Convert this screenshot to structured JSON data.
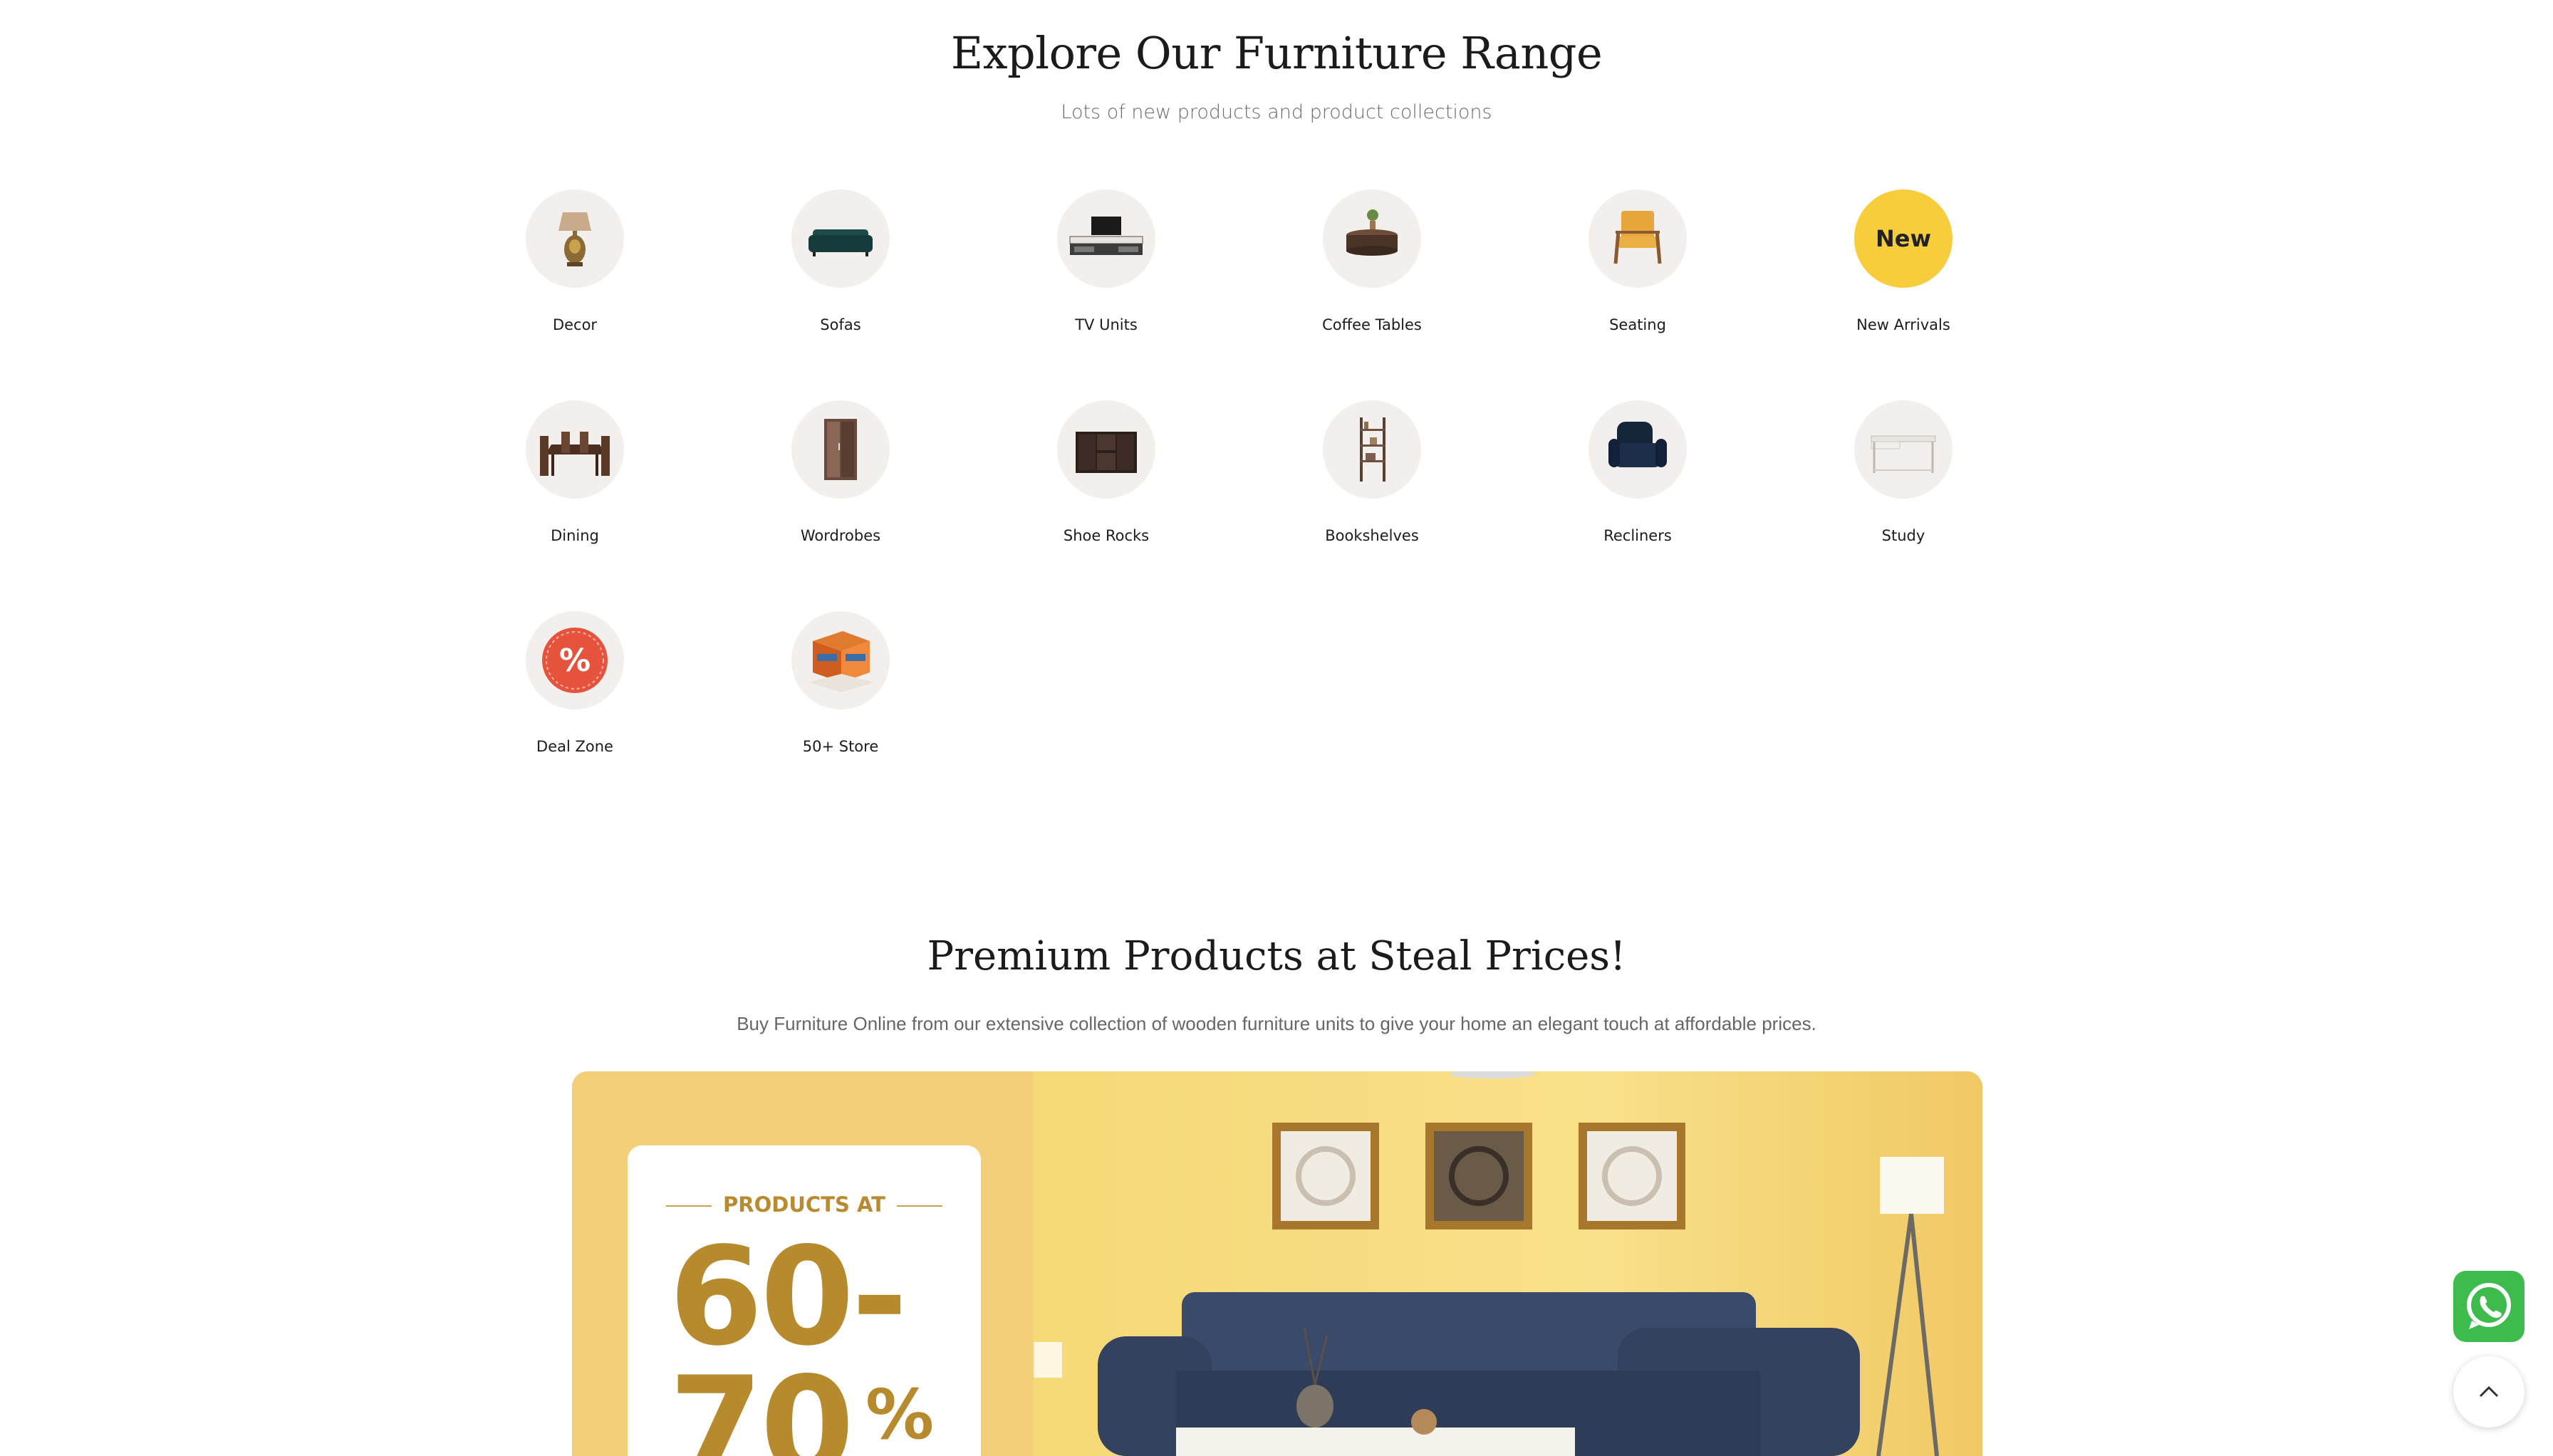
{
  "explore": {
    "title": "Explore Our Furniture Range",
    "subtitle": "Lots of new products and product collections",
    "categories": [
      {
        "label": "Decor",
        "icon": "lamp-icon"
      },
      {
        "label": "Sofas",
        "icon": "sofa-icon"
      },
      {
        "label": "TV Units",
        "icon": "tv-unit-icon"
      },
      {
        "label": "Coffee Tables",
        "icon": "coffee-table-icon"
      },
      {
        "label": "Seating",
        "icon": "armchair-icon"
      },
      {
        "label": "New Arrivals",
        "icon": "new-badge-icon",
        "badge": "New"
      },
      {
        "label": "Dining",
        "icon": "dining-set-icon"
      },
      {
        "label": "Wordrobes",
        "icon": "wardrobe-icon"
      },
      {
        "label": "Shoe Rocks",
        "icon": "shoe-rack-icon"
      },
      {
        "label": "Bookshelves",
        "icon": "bookshelf-icon"
      },
      {
        "label": "Recliners",
        "icon": "recliner-icon"
      },
      {
        "label": "Study",
        "icon": "study-desk-icon"
      },
      {
        "label": "Deal Zone",
        "icon": "percent-badge-icon",
        "badge": "%"
      },
      {
        "label": "50+ Store",
        "icon": "store-icon"
      }
    ]
  },
  "premium": {
    "title": "Premium Products at Steal Prices!",
    "subtitle": "Buy Furniture Online from our extensive collection of wooden furniture units to give your home an elegant touch at affordable prices.",
    "banner": {
      "kicker": "PRODUCTS AT",
      "line1": "60-",
      "line2": "70",
      "percent": "%"
    }
  },
  "colors": {
    "accent_yellow": "#f7cd3b",
    "banner_bg": "#f3cf7a",
    "offer_gold": "#b88a2e",
    "whatsapp_green": "#3dbb4c",
    "circle_bg": "#f3efec"
  },
  "floating": {
    "whatsapp_icon": "whatsapp-icon",
    "scroll_top_icon": "chevron-up-icon"
  }
}
